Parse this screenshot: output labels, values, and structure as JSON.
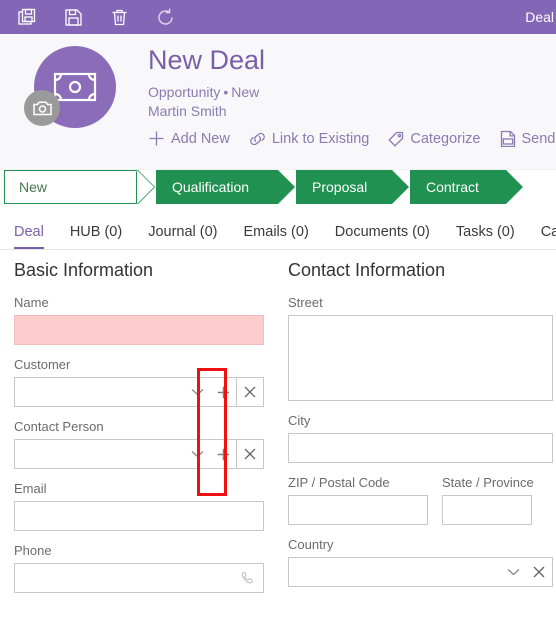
{
  "toolbar": {
    "title": "Deal",
    "buttons": [
      {
        "name": "save-as-icon",
        "label": "Save As"
      },
      {
        "name": "save-icon",
        "label": "Save"
      },
      {
        "name": "delete-icon",
        "label": "Delete"
      },
      {
        "name": "refresh-icon",
        "label": "Refresh"
      }
    ]
  },
  "header": {
    "title": "New Deal",
    "type": "Opportunity",
    "separator": "•",
    "status": "New",
    "owner": "Martin Smith",
    "avatar_icon": "banknote-icon",
    "camera_badge_icon": "camera-icon",
    "actions": [
      {
        "label": "Add New",
        "icon": "plus-icon"
      },
      {
        "label": "Link to Existing",
        "icon": "link-icon"
      },
      {
        "label": "Categorize",
        "icon": "tag-icon"
      },
      {
        "label": "Send",
        "icon": "pdf-icon"
      }
    ]
  },
  "stages": [
    {
      "label": "New",
      "active": true
    },
    {
      "label": "Qualification",
      "active": false
    },
    {
      "label": "Proposal",
      "active": false
    },
    {
      "label": "Contract",
      "active": false
    }
  ],
  "tabs": [
    {
      "label": "Deal",
      "active": true
    },
    {
      "label": "HUB (0)",
      "active": false
    },
    {
      "label": "Journal (0)",
      "active": false
    },
    {
      "label": "Emails (0)",
      "active": false
    },
    {
      "label": "Documents (0)",
      "active": false
    },
    {
      "label": "Tasks (0)",
      "active": false
    },
    {
      "label": "Calen",
      "active": false
    }
  ],
  "basic_information": {
    "title": "Basic Information",
    "name": {
      "label": "Name",
      "value": "",
      "required": true
    },
    "customer": {
      "label": "Customer",
      "value": ""
    },
    "contact_person": {
      "label": "Contact Person",
      "value": ""
    },
    "email": {
      "label": "Email",
      "value": ""
    },
    "phone": {
      "label": "Phone",
      "value": "",
      "icon": "phone-icon"
    }
  },
  "contact_information": {
    "title": "Contact Information",
    "street": {
      "label": "Street",
      "value": ""
    },
    "city": {
      "label": "City",
      "value": ""
    },
    "zip": {
      "label": "ZIP / Postal Code",
      "value": ""
    },
    "state": {
      "label": "State / Province",
      "value": ""
    },
    "country": {
      "label": "Country",
      "value": ""
    }
  },
  "colors": {
    "toolbar_purple": "#8367b6",
    "avatar_purple": "#8b6cb8",
    "accent_purple": "#7a5fa8",
    "stage_green": "#209150",
    "required_pink": "#fdcccc",
    "annotation_red": "#ee1111"
  },
  "annotation": {
    "shape": "rectangle",
    "color": "#ee1111",
    "highlights": "add-new-plus-buttons"
  }
}
